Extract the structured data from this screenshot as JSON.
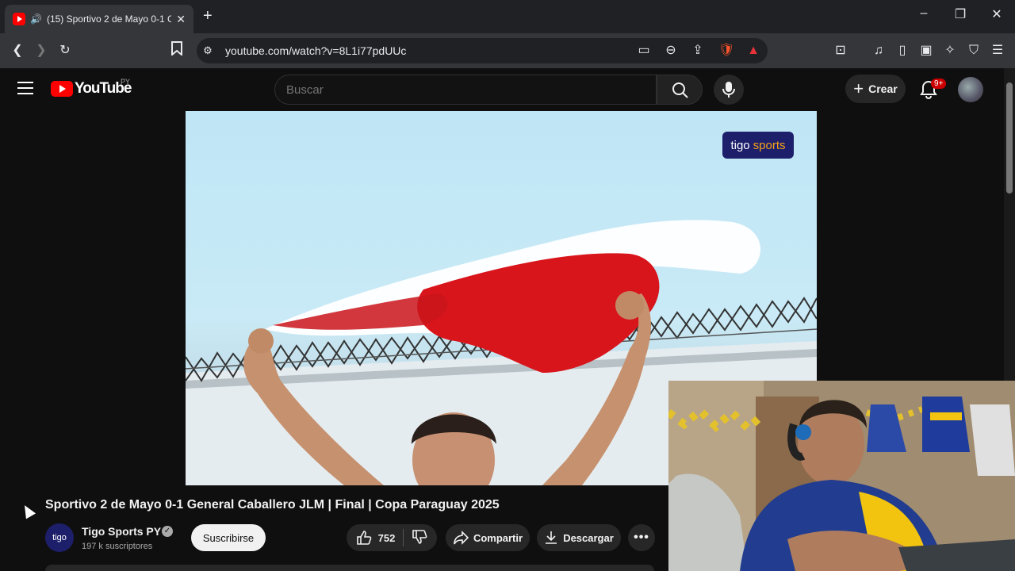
{
  "browser": {
    "tab_title": "(15) Sportivo 2 de Mayo 0-1 G",
    "url": "youtube.com/watch?v=8L1i77pdUUc"
  },
  "youtube": {
    "logo_text": "YouTube",
    "country_code": "PY",
    "search_placeholder": "Buscar",
    "create_label": "Crear",
    "notification_badge": "9+"
  },
  "video": {
    "watermark_brand": "tigo",
    "watermark_sub": "sports",
    "title": "Sportivo 2 de Mayo 0-1 General Caballero JLM | Final | Copa Paraguay 2025"
  },
  "channel": {
    "name": "Tigo Sports PY",
    "subscribers": "197 k suscriptores",
    "avatar_text": "tigo",
    "subscribe_label": "Suscribirse"
  },
  "actions": {
    "likes": "752",
    "share_label": "Compartir",
    "download_label": "Descargar"
  },
  "colors": {
    "youtube_red": "#ff0000",
    "tigo_navy": "#1d1f6b",
    "tigo_orange": "#f6a21a"
  }
}
